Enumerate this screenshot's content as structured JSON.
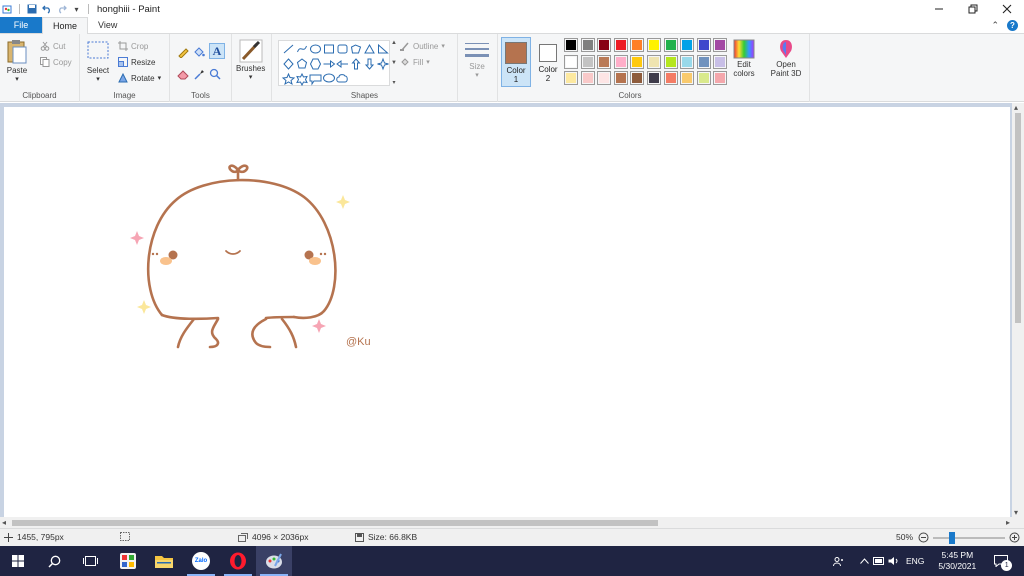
{
  "window": {
    "title": "honghiii - Paint"
  },
  "tabs": {
    "file": "File",
    "home": "Home",
    "view": "View"
  },
  "ribbon": {
    "clipboard": {
      "label": "Clipboard",
      "paste": "Paste",
      "cut": "Cut",
      "copy": "Copy"
    },
    "image": {
      "label": "Image",
      "select": "Select",
      "crop": "Crop",
      "resize": "Resize",
      "rotate": "Rotate"
    },
    "tools": {
      "label": "Tools"
    },
    "brushes": {
      "label": "Brushes"
    },
    "shapes": {
      "label": "Shapes",
      "outline": "Outline",
      "fill": "Fill"
    },
    "size": {
      "label": "Size"
    },
    "colors": {
      "label": "Colors",
      "color1": "Color",
      "color1_num": "1",
      "color2": "Color",
      "color2_num": "2",
      "edit_colors_1": "Edit",
      "edit_colors_2": "colors",
      "paint3d_1": "Open",
      "paint3d_2": "Paint 3D",
      "color1_value": "#b5734f",
      "color2_value": "#ffffff",
      "palette_row1": [
        "#000000",
        "#7f7f7f",
        "#880015",
        "#ed1c24",
        "#ff7f27",
        "#fff200",
        "#22b14c",
        "#00a2e8",
        "#3f48cc",
        "#a349a4"
      ],
      "palette_row2": [
        "#ffffff",
        "#c3c3c3",
        "#b97a57",
        "#ffaec9",
        "#ffc90e",
        "#efe4b0",
        "#b5e61d",
        "#99d9ea",
        "#7092be",
        "#c8bfe7"
      ],
      "palette_row3": [
        "#fde9a0",
        "#f9c9c9",
        "#fde5e5",
        "#b5734f",
        "#8e5c3c",
        "#3e3b4a",
        "#f47c65",
        "#f9ca6d",
        "#d9e98c",
        "#f4a7ac"
      ]
    }
  },
  "canvas": {
    "signature": "@Ku",
    "stroke_color": "#b5734f"
  },
  "status": {
    "cursor_pos": "1455, 795px",
    "dimensions": "4096 × 2036px",
    "size": "Size: 66.8KB",
    "zoom": "50%"
  },
  "taskbar": {
    "lang": "ENG",
    "time": "5:45 PM",
    "date": "5/30/2021",
    "zalo": "Zalo",
    "notif_count": "1"
  }
}
